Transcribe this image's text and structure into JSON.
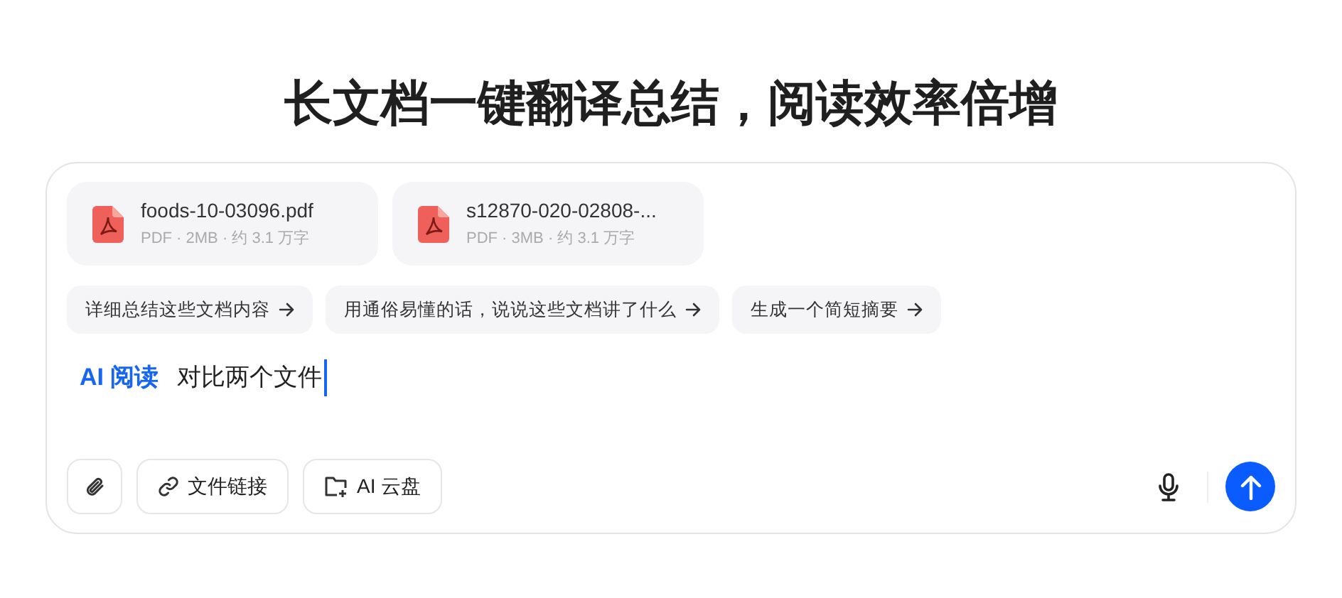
{
  "heading": "长文档一键翻译总结，阅读效率倍增",
  "files": [
    {
      "kind": "pdf",
      "name": "foods-10-03096.pdf",
      "meta": "PDF · 2MB · 约 3.1 万字"
    },
    {
      "kind": "pdf",
      "name": "s12870-020-02808-...",
      "meta": "PDF · 3MB · 约 3.1 万字"
    }
  ],
  "suggestions": [
    "详细总结这些文档内容",
    "用通俗易懂的话，说说这些文档讲了什么",
    "生成一个简短摘要"
  ],
  "input": {
    "mode": "AI 阅读",
    "value": "对比两个文件"
  },
  "toolbar": [
    {
      "kind": "attach"
    },
    {
      "kind": "link",
      "label": "文件链接"
    },
    {
      "kind": "cloud",
      "label": "AI 云盘"
    }
  ]
}
